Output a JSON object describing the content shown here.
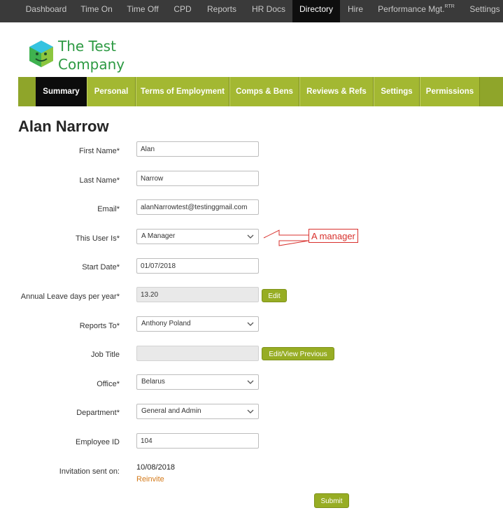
{
  "topnav": {
    "items": [
      "Dashboard",
      "Time On",
      "Time Off",
      "CPD",
      "Reports",
      "HR Docs",
      "Directory",
      "Hire",
      "Performance Mgt.",
      "Settings"
    ],
    "performance_superscript": "RTR",
    "active": "Directory"
  },
  "company": {
    "name_line1": "The Test",
    "name_line2": "Company"
  },
  "tabs": [
    "Summary",
    "Personal",
    "Terms of Employment",
    "Comps & Bens",
    "Reviews & Refs",
    "Settings",
    "Permissions"
  ],
  "active_tab": "Summary",
  "person": {
    "name": "Alan Narrow"
  },
  "form": {
    "first_name": {
      "label": "First Name*",
      "value": "Alan"
    },
    "last_name": {
      "label": "Last Name*",
      "value": "Narrow"
    },
    "email": {
      "label": "Email*",
      "value": "alanNarrowtest@testinggmail.com"
    },
    "user_is": {
      "label": "This User Is*",
      "value": "A Manager"
    },
    "start_date": {
      "label": "Start Date*",
      "value": "01/07/2018"
    },
    "annual_leave": {
      "label": "Annual Leave days per year*",
      "value": "13.20",
      "button": "Edit"
    },
    "reports_to": {
      "label": "Reports To*",
      "value": "Anthony Poland"
    },
    "job_title": {
      "label": "Job Title",
      "value": "",
      "button": "Edit/View Previous"
    },
    "office": {
      "label": "Office*",
      "value": "Belarus"
    },
    "department": {
      "label": "Department*",
      "value": "General and Admin"
    },
    "employee_id": {
      "label": "Employee ID",
      "value": "104"
    },
    "invitation": {
      "label": "Invitation sent on:",
      "date": "10/08/2018",
      "reinvite": "Reinvite"
    },
    "submit": "Submit"
  },
  "annotation": {
    "text": "A manager",
    "color": "#d8302c"
  },
  "colors": {
    "brand_green": "#a3b832",
    "nav_dark": "#3a3a3a",
    "logo_green": "#2d9a43",
    "link_orange": "#d47a1a"
  }
}
